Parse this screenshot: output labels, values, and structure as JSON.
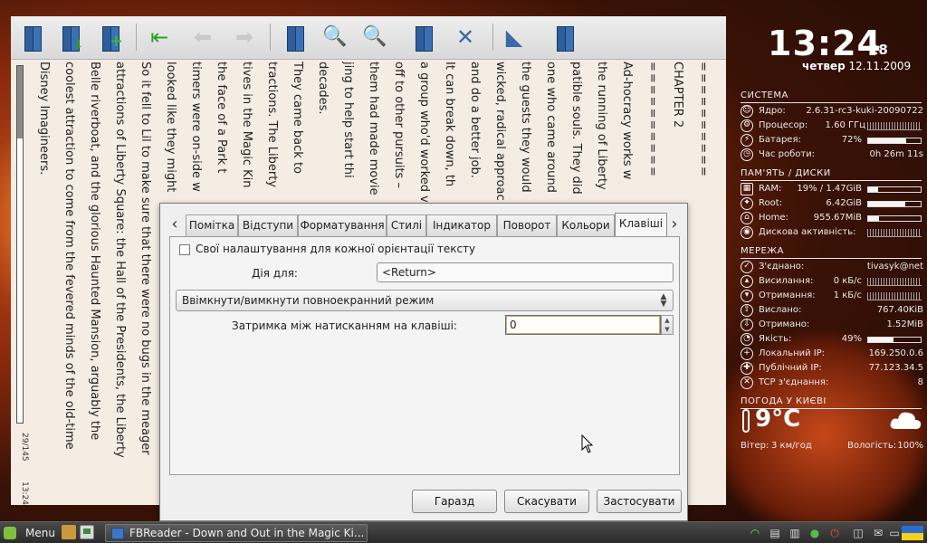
{
  "reader": {
    "page_counter": "29/145",
    "clock": "13:24",
    "columns": [
      "==========",
      "CHAPTER 2",
      "==========",
      "Ad-hocracy works w",
      "the running of Liberty",
      "patible souls. They did",
      "one who came around",
      "the guests they would",
      "wicked, radical approac",
      "and do a better job.",
      "It can break down, th",
      "a group who'd worked v",
      "off to other pursuits –",
      "them had made movie",
      "jing to help start thi",
      "decades.",
      "They came back to",
      "tractions. The Liberty",
      "tives in the Magic Kin",
      "the face of a Park t",
      "timers were on-side w",
      "looked like they might",
      "So it fell to Lil to make sure that there were no bugs in the meager",
      "attractions of Liberty Square: the Hall of the Presidents, the Liberty",
      "Belle riverboat, and the glorious Haunted Mansion, arguably the",
      "coolest attraction to come from the fevered minds of the old-time",
      "Disney Imagineers."
    ]
  },
  "dialog": {
    "tabs": [
      "Помітка",
      "Відступи",
      "Форматування",
      "Стилі",
      "Індикатор",
      "Поворот",
      "Кольори",
      "Клавіші"
    ],
    "active_tab": "Клавіші",
    "checkbox_label": "Свої налаштування для кожної орієнтації тексту",
    "action_label": "Дія для:",
    "action_value": "<Return>",
    "combo_value": "Ввімкнути/вимкнути повноекранний режим",
    "delay_label": "Затримка між натисканням на клавіші:",
    "delay_value": "0",
    "buttons": {
      "ok": "Гаразд",
      "cancel": "Скасувати",
      "apply": "Застосувати"
    }
  },
  "conky": {
    "time": "13:24",
    "seconds": "28",
    "weekday": "четвер",
    "date": "12.11.2009",
    "system_title": "СИСТЕМА",
    "kernel_label": "Ядро:",
    "kernel_value": "2.6.31-rc3-kuki-20090722",
    "cpu_label": "Процесор:",
    "cpu_value": "1.60 ГГц",
    "battery_label": "Батарея:",
    "battery_value": "72%",
    "battery_level": 72,
    "uptime_label": "Час роботи:",
    "uptime_value": "0h 26m 11s",
    "memory_title": "ПАМ'ЯТЬ / ДИСКИ",
    "ram_label": "RAM:",
    "ram_value": "19% / 1.47GiB",
    "ram_level": 19,
    "root_label": "Root:",
    "root_value": "6.42GiB",
    "root_level": 70,
    "home_label": "Home:",
    "home_value": "955.67MiB",
    "home_level": 20,
    "disk_label": "Дискова активність:",
    "network_title": "МЕРЕЖА",
    "connected_label": "З'єднано:",
    "connected_value": "tivasyk@net",
    "up_label": "Висилання:",
    "up_value": "0 кБ/с",
    "down_label": "Отримання:",
    "down_value": "1 кБ/с",
    "sent_label": "Вислано:",
    "sent_value": "767.40KiB",
    "received_label": "Отримано:",
    "received_value": "1.52MiB",
    "quality_label": "Якість:",
    "quality_value": "49%",
    "quality_level": 49,
    "local_ip_label": "Локальний IP:",
    "local_ip_value": "169.250.0.6",
    "public_ip_label": "Публічний IP:",
    "public_ip_value": "77.123.34.5",
    "tcp_label": "TCP з'єднання:",
    "tcp_value": "8",
    "weather_title": "ПОГОДА У КИЄВІ",
    "temperature": "9°C",
    "wind_label": "Вітер:",
    "wind_value": "3 км/год",
    "humidity_label": "Вологість:",
    "humidity_value": "100%"
  },
  "taskbar": {
    "menu_label": "Menu",
    "task_title": "FBReader - Down and Out in the Magic Ki..."
  }
}
